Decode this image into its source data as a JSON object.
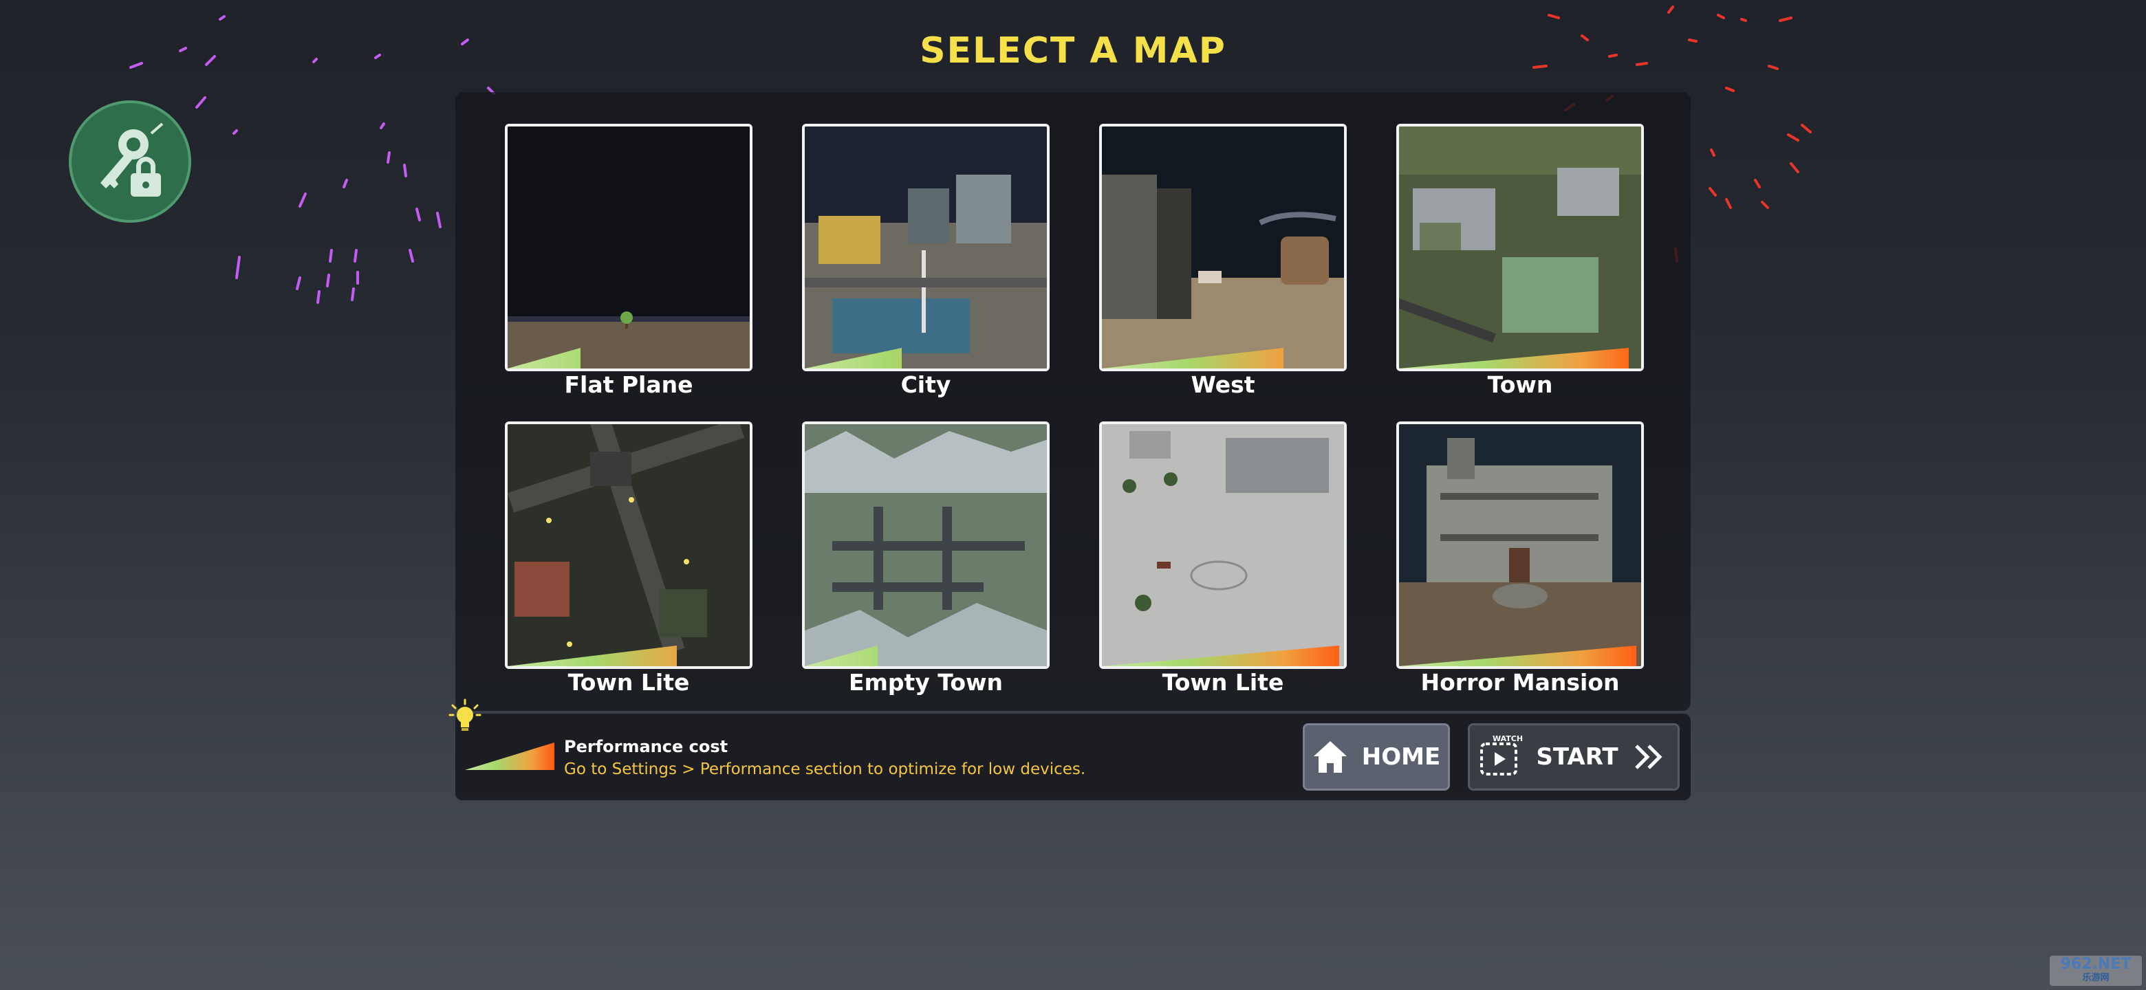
{
  "title": "SELECT A MAP",
  "maps": [
    {
      "name": "Flat Plane",
      "performance": 0.3,
      "scene": "flat-plane"
    },
    {
      "name": "City",
      "performance": 0.4,
      "scene": "city"
    },
    {
      "name": "West",
      "performance": 0.75,
      "scene": "west"
    },
    {
      "name": "Town",
      "performance": 0.95,
      "scene": "town"
    },
    {
      "name": "Town Lite",
      "performance": 0.7,
      "scene": "town-lite-night"
    },
    {
      "name": "Empty Town",
      "performance": 0.3,
      "scene": "empty-town"
    },
    {
      "name": "Town Lite",
      "performance": 0.98,
      "scene": "town-lite-snow"
    },
    {
      "name": "Horror Mansion",
      "performance": 0.98,
      "scene": "horror-mansion"
    }
  ],
  "hint": {
    "title": "Performance cost",
    "text": "Go to Settings > Performance section to optimize for low devices."
  },
  "buttons": {
    "home": "HOME",
    "start": "START",
    "watch": "WATCH"
  },
  "watermark": {
    "main": "962.NET",
    "sub": "乐游网"
  },
  "icons": {
    "lock": "key-lock-icon",
    "bulb": "lightbulb-icon",
    "home": "home-icon",
    "start": "video-play-icon",
    "chevrons": "double-chevron-right-icon"
  },
  "colors": {
    "title": "#f5e04a",
    "hint": "#f4c542",
    "lock_bg": "#2e6e4b"
  }
}
